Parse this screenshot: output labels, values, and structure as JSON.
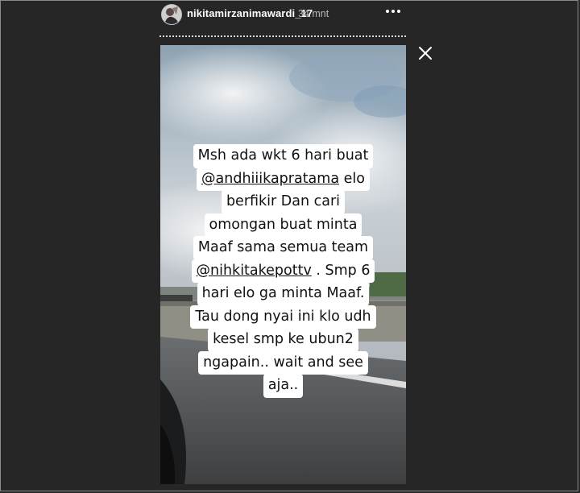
{
  "header": {
    "username": "nikitamirzanimawardi_17",
    "timestamp": "34 mnt",
    "avatar_icon": "user-avatar",
    "more_icon": "more-horizontal-icon",
    "close_icon": "close-icon"
  },
  "story": {
    "caption_lines": [
      {
        "before": "Msh ada wkt 6 hari buat",
        "mention": "",
        "after": ""
      },
      {
        "before": "",
        "mention": "@andhiiikapratama",
        "after": " elo"
      },
      {
        "before": "berfikir Dan cari",
        "mention": "",
        "after": ""
      },
      {
        "before": "omongan buat minta",
        "mention": "",
        "after": ""
      },
      {
        "before": "Maaf sama semua team",
        "mention": "",
        "after": ""
      },
      {
        "before": "",
        "mention": "@nihkitakepottv",
        "after": " . Smp 6"
      },
      {
        "before": "hari elo ga minta Maaf.",
        "mention": "",
        "after": ""
      },
      {
        "before": "Tau dong nyai ini klo udh",
        "mention": "",
        "after": ""
      },
      {
        "before": "kesel smp ke ubun2",
        "mention": "",
        "after": ""
      },
      {
        "before": "ngapain.. wait and see",
        "mention": "",
        "after": ""
      },
      {
        "before": "aja..",
        "mention": "",
        "after": ""
      }
    ]
  },
  "colors": {
    "page_bg": "#262626",
    "caption_bg": "#ffffff",
    "caption_text": "#111111"
  }
}
